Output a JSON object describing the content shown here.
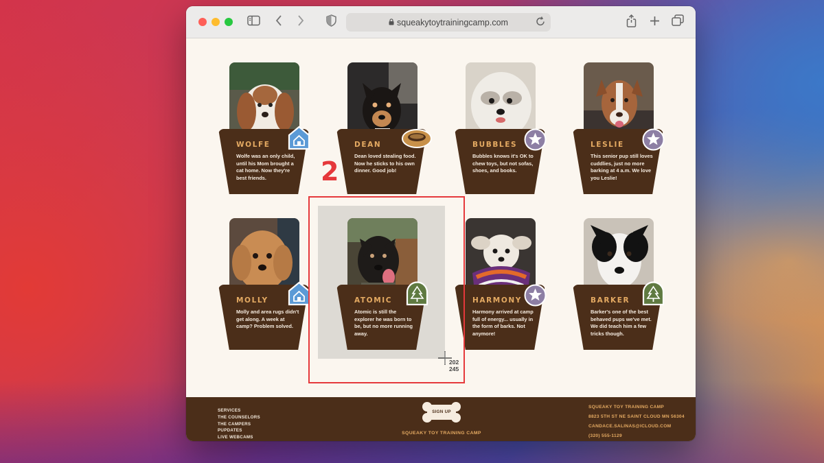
{
  "browser": {
    "url": "squeakytoytrainingcamp.com",
    "icons": [
      "sidebar-icon",
      "back-icon",
      "forward-icon",
      "shield-icon",
      "reload-icon",
      "share-icon",
      "new-tab-icon",
      "tabs-icon"
    ]
  },
  "dogs": [
    {
      "name": "WOLFE",
      "desc": "Wolfe was an only child, until his Mom brought a cat home. Now they're best friends.",
      "badge": "house-icon"
    },
    {
      "name": "DEAN",
      "desc": "Dean loved stealing food. Now he sticks to his own dinner. Good job!",
      "badge": "bowl-icon"
    },
    {
      "name": "BUBBLES",
      "desc": "Bubbles knows it's OK to chew toys, but not sofas, shoes, and books.",
      "badge": "star-icon"
    },
    {
      "name": "LESLIE",
      "desc": "This senior pup still loves cuddlies, just no more barking at 4 a.m. We love you Leslie!",
      "badge": "star-icon"
    },
    {
      "name": "MOLLY",
      "desc": "Molly and area rugs didn't get along. A week at camp? Problem solved.",
      "badge": "house-icon"
    },
    {
      "name": "ATOMIC",
      "desc": "Atomic is still the explorer he was born to be, but no more running away.",
      "badge": "tree-icon"
    },
    {
      "name": "HARMONY",
      "desc": "Harmony arrived at camp full of energy... usually in the form of barks. Not anymore!",
      "badge": "star-icon"
    },
    {
      "name": "BARKER",
      "desc": "Barker's one of the best behaved pups we've met. We did teach him a few tricks though.",
      "badge": "tree-icon"
    }
  ],
  "annotation": {
    "step_number": "2",
    "coords_line1": "202",
    "coords_line2": "245"
  },
  "footer": {
    "links": [
      "SERVICES",
      "THE COUNSELORS",
      "THE CAMPERS",
      "PUPDATES",
      "LIVE WEBCAMS"
    ],
    "signup_label": "SIGN UP",
    "brand": "SQUEAKY TOY TRAINING CAMP",
    "contact": {
      "name": "SQUEAKY TOY TRAINING CAMP",
      "address": "8823 5TH ST NE SAINT CLOUD MN 56304",
      "email": "CANDACE.SALINAS@ICLOUD.COM",
      "phone": "(320) 555-1129"
    }
  },
  "colors": {
    "brown": "#4b2e19",
    "accent": "#e4aa62",
    "cream": "#fbf6ef",
    "selection": "#e5383b",
    "house_badge": "#5b9ad6",
    "star_badge": "#8d7fa4",
    "tree_badge": "#5f7a41",
    "bowl_badge": "#c8914a"
  }
}
